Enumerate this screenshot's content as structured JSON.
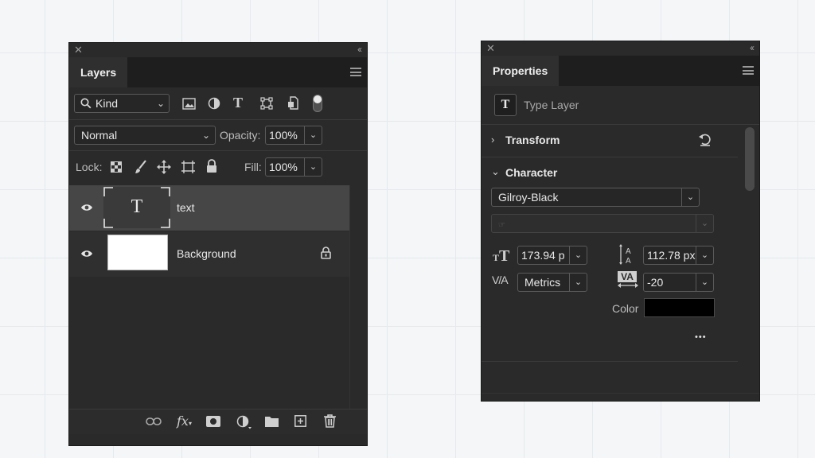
{
  "layers_panel": {
    "title": "Layers",
    "filter": {
      "label": "Kind"
    },
    "blend_mode": "Normal",
    "opacity_label": "Opacity:",
    "opacity_value": "100%",
    "lock_label": "Lock:",
    "fill_label": "Fill:",
    "fill_value": "100%",
    "layers": [
      {
        "name": "text",
        "thumb_glyph": "T",
        "selected": true
      },
      {
        "name": "Background",
        "locked": true
      }
    ],
    "footer_icons": [
      "link-icon",
      "fx-icon",
      "mask-icon",
      "adjustment-icon",
      "folder-icon",
      "new-layer-icon",
      "trash-icon"
    ],
    "fx_label": "fx"
  },
  "properties_panel": {
    "title": "Properties",
    "layer_type_icon": "T",
    "layer_type": "Type Layer",
    "sections": {
      "transform": "Transform",
      "character": "Character"
    },
    "font_family": "Gilroy-Black",
    "font_size": "173.94 p",
    "leading": "112.78 px",
    "kerning": "Metrics",
    "tracking": "-20",
    "color_label": "Color",
    "text_color": "#000000",
    "more": "•••",
    "kerning_icon_text": "V/A",
    "tracking_icon_text": "VA"
  },
  "colors": {
    "panel_bg": "#2a2a2a",
    "selected_row": "#464646",
    "accent_text": "#efefef"
  }
}
